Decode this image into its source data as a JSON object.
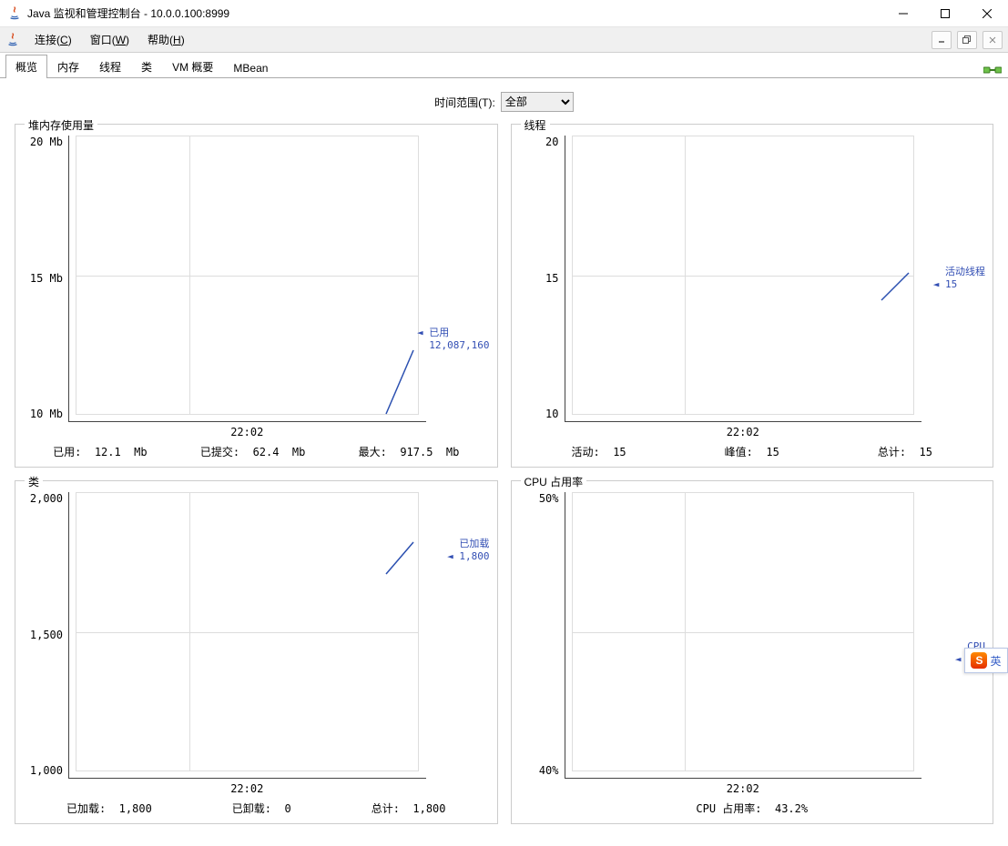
{
  "window": {
    "title": "Java 监视和管理控制台 - 10.0.0.100:8999"
  },
  "menu": {
    "connect": "连接",
    "connect_u": "C",
    "window": "窗口",
    "window_u": "W",
    "help": "帮助",
    "help_u": "H"
  },
  "tabs": {
    "overview": "概览",
    "memory": "内存",
    "threads": "线程",
    "classes": "类",
    "vmsummary": "VM 概要",
    "mbean": "MBean"
  },
  "timerange": {
    "label": "时间范围(T):",
    "value": "全部"
  },
  "heap": {
    "title": "堆内存使用量",
    "ytick_hi": "20 Mb",
    "ytick_mid": "15 Mb",
    "ytick_lo": "10 Mb",
    "xlabel": "22:02",
    "legend_label": "已用",
    "legend_value": "12,087,160",
    "status_used_l": "已用:",
    "status_used_v": "12.1  Mb",
    "status_commit_l": "已提交:",
    "status_commit_v": "62.4  Mb",
    "status_max_l": "最大:",
    "status_max_v": "917.5  Mb"
  },
  "threads": {
    "title": "线程",
    "ytick_hi": "20",
    "ytick_mid": "15",
    "ytick_lo": "10",
    "xlabel": "22:02",
    "legend_label": "活动线程",
    "legend_value": "15",
    "status_live_l": "活动:",
    "status_live_v": "15",
    "status_peak_l": "峰值:",
    "status_peak_v": "15",
    "status_total_l": "总计:",
    "status_total_v": "15"
  },
  "classes": {
    "title": "类",
    "ytick_hi": "2,000",
    "ytick_mid": "1,500",
    "ytick_lo": "1,000",
    "xlabel": "22:02",
    "legend_label": "已加载",
    "legend_value": "1,800",
    "status_loaded_l": "已加载:",
    "status_loaded_v": "1,800",
    "status_unloaded_l": "已卸载:",
    "status_unloaded_v": "0",
    "status_total_l": "总计:",
    "status_total_v": "1,800"
  },
  "cpu": {
    "title": "CPU 占用率",
    "ytick_hi": "50%",
    "ytick_lo": "40%",
    "xlabel": "22:02",
    "legend_label": "CPU",
    "legend_value": "43.",
    "status_l": "CPU 占用率:",
    "status_v": "43.2%"
  },
  "ime": {
    "s": "S",
    "lang": "英"
  },
  "chart_data": [
    {
      "type": "line",
      "title": "堆内存使用量",
      "x": [
        "22:02"
      ],
      "series": [
        {
          "name": "已用",
          "values_bytes": [
            12087160
          ]
        }
      ],
      "ylabel": "Mb",
      "ylim_mb": [
        10,
        20
      ]
    },
    {
      "type": "line",
      "title": "线程",
      "x": [
        "22:02"
      ],
      "series": [
        {
          "name": "活动线程",
          "values": [
            15
          ]
        }
      ],
      "ylim": [
        10,
        20
      ]
    },
    {
      "type": "line",
      "title": "类",
      "x": [
        "22:02"
      ],
      "series": [
        {
          "name": "已加载",
          "values": [
            1800
          ]
        }
      ],
      "ylim": [
        1000,
        2000
      ]
    },
    {
      "type": "line",
      "title": "CPU 占用率",
      "x": [
        "22:02"
      ],
      "series": [
        {
          "name": "CPU",
          "values_pct": [
            43.2
          ]
        }
      ],
      "ylim_pct": [
        40,
        50
      ]
    }
  ]
}
